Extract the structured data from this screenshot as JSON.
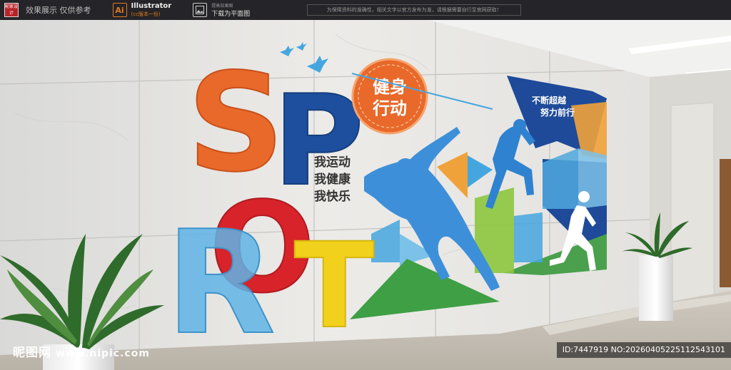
{
  "top_bar": {
    "logo_text": "昵家设计",
    "effect_text": "效果展示 仅供参考",
    "ai_mark": "Ai",
    "ai_title": "Illustrator",
    "ai_subtitle": "(cc版本一份)",
    "pic_small": "提高效果图",
    "pic_label": "下载为平面图",
    "notice": "为保障资料的准确性，相关文字以官方发布为准，请根据需要自行至官网获取！"
  },
  "wall": {
    "letters": [
      "S",
      "P",
      "O",
      "R",
      "O",
      "T"
    ],
    "badge_line1": "健身",
    "badge_line2": "行动",
    "slogan": [
      "我运动",
      "我健康",
      "我快乐"
    ],
    "corner_line1": "不断超越",
    "corner_line2": "努力前行"
  },
  "watermark": {
    "site": "昵图网",
    "url": "www.nipic.com",
    "id_text": "ID:7447919 NO:20260405225112543101"
  },
  "colors": {
    "orange": "#e8692a",
    "blue": "#1d4f9e",
    "red": "#d8232a",
    "yellow": "#f2d11c",
    "green": "#3f9f45",
    "lightblue": "#45a6df",
    "lime": "#8cc63e",
    "navy": "#1e4a99"
  }
}
